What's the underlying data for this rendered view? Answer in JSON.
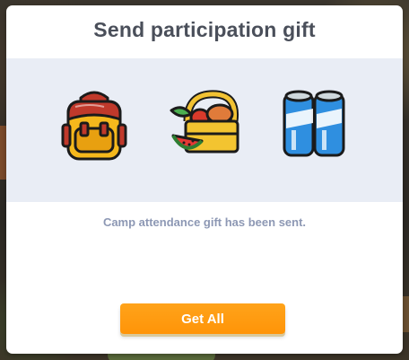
{
  "dialog": {
    "title": "Send participation gift",
    "status_message": "Camp attendance gift has been sent.",
    "get_all_label": "Get All"
  },
  "gifts": [
    {
      "icon": "backpack-icon"
    },
    {
      "icon": "picnic-basket-icon"
    },
    {
      "icon": "energy-drink-cans-icon"
    }
  ],
  "colors": {
    "title": "#4a4f5a",
    "panel": "#e9edf5",
    "status_text": "#8d98b4",
    "button": "#ff9a10"
  }
}
